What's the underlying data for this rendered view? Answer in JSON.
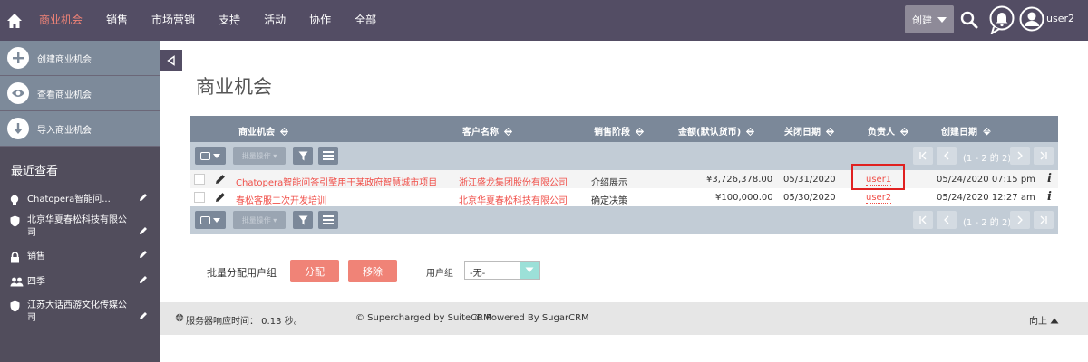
{
  "nav": {
    "items": [
      "商业机会",
      "销售",
      "市场营销",
      "支持",
      "活动",
      "协作",
      "全部"
    ],
    "create_label": "创建",
    "user_label": "user2"
  },
  "sidebar": {
    "actions": [
      "创建商业机会",
      "查看商业机会",
      "导入商业机会"
    ],
    "recent_title": "最近查看",
    "recent_items": [
      {
        "icon": "lightbulb-icon",
        "label": "Chatopera智能问..."
      },
      {
        "icon": "shield-icon",
        "label": "北京华夏春松科技有限公司"
      },
      {
        "icon": "lock-icon",
        "label": "销售"
      },
      {
        "icon": "users-icon",
        "label": "四季"
      },
      {
        "icon": "shield-icon",
        "label": "江苏大话西游文化传媒公司"
      }
    ]
  },
  "page_title": "商业机会",
  "table": {
    "headers": [
      "商业机会",
      "客户名称",
      "销售阶段",
      "金额(默认货币)",
      "关闭日期",
      "负责人",
      "创建日期"
    ],
    "bulk_label": "批量操作",
    "pagination": "(1 - 2 的 2)",
    "rows": [
      {
        "name": "Chatopera智能问答引擎用于某政府智慧城市项目",
        "account": "浙江盛龙集团股份有限公司",
        "stage": "介绍展示",
        "amount": "¥3,726,378.00",
        "close_date": "05/31/2020",
        "owner": "user1",
        "created": "05/24/2020 07:15 pm"
      },
      {
        "name": "春松客服二次开发培训",
        "account": "北京华夏春松科技有限公司",
        "stage": "确定决策",
        "amount": "¥100,000.00",
        "close_date": "05/30/2020",
        "owner": "user2",
        "created": "05/24/2020 12:27 am"
      }
    ]
  },
  "mass_assign": {
    "label": "批量分配用户组",
    "assign_button": "分配",
    "remove_button": "移除",
    "group_label": "用户组",
    "group_value": "-无-"
  },
  "footer": {
    "response_time": "服务器响应时间： 0.13 秒。",
    "suite": "© Supercharged by SuiteCRM",
    "sugar": "© Powered By SugarCRM",
    "back_to_top": "向上"
  },
  "colors": {
    "nav_bg": "#534d64",
    "accent": "#f08377",
    "link": "#f0504a",
    "table_header": "#7b8899"
  }
}
